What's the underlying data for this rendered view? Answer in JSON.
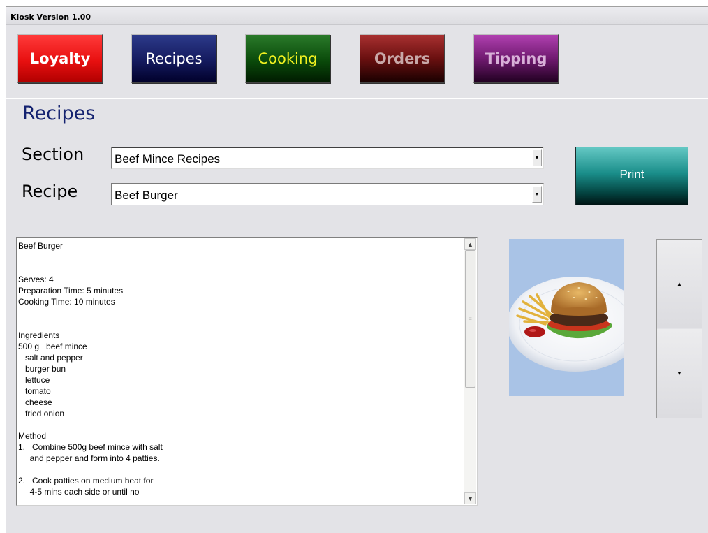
{
  "window": {
    "title": "Kiosk Version 1.00"
  },
  "nav": {
    "loyalty": "Loyalty",
    "recipes": "Recipes",
    "cooking": "Cooking",
    "orders": "Orders",
    "tipping": "Tipping"
  },
  "page": {
    "title": "Recipes"
  },
  "form": {
    "section_label": "Section",
    "section_value": "Beef Mince Recipes",
    "recipe_label": "Recipe",
    "recipe_value": "Beef Burger"
  },
  "print_label": "Print",
  "recipe_text": "Beef Burger\n\n\nServes: 4\nPreparation Time: 5 minutes\nCooking Time: 10 minutes\n\n\nIngredients\n500 g   beef mince\n   salt and pepper\n   burger bun\n   lettuce\n   tomato\n   cheese\n   fried onion\n\nMethod\n1.   Combine 500g beef mince with salt\n     and pepper and form into 4 patties.\n\n2.   Cook patties on medium heat for\n     4-5 mins each side or until no",
  "icons": {
    "dropdown": "chevron-down-icon",
    "scroll_up": "arrow-up-icon",
    "scroll_down": "arrow-down-icon",
    "step_up": "triangle-up-icon",
    "step_down": "triangle-down-icon"
  },
  "colors": {
    "title_blue": "#142270",
    "loyalty": "#e81010",
    "recipes": "#141a5e",
    "cooking": "#0a4a0a",
    "orders": "#6a1010",
    "tipping": "#701a70",
    "print": "#1a8e8a"
  }
}
